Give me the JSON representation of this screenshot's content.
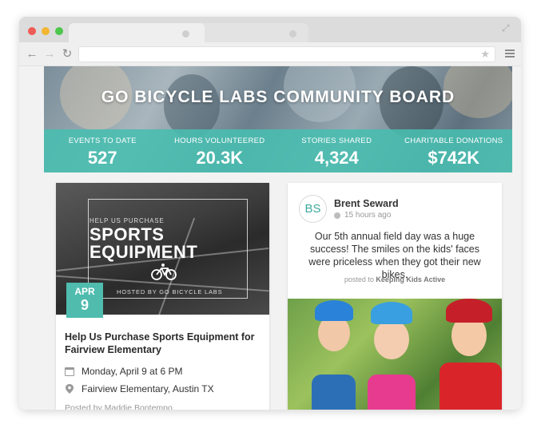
{
  "hero": {
    "title": "GO BICYCLE LABS COMMUNITY BOARD",
    "stats": [
      {
        "label": "EVENTS TO DATE",
        "value": "527"
      },
      {
        "label": "HOURS VOLUNTEERED",
        "value": "20.3K"
      },
      {
        "label": "STORIES SHARED",
        "value": "4,324"
      },
      {
        "label": "CHARITABLE DONATIONS",
        "value": "$742K"
      }
    ]
  },
  "event": {
    "graphic_line1": "HELP US PURCHASE",
    "graphic_line2": "SPORTS",
    "graphic_line3": "EQUIPMENT",
    "graphic_host": "HOSTED BY GO BICYCLE LABS",
    "date_month": "APR",
    "date_day": "9",
    "title": "Help Us Purchase Sports Equipment for Fairview Elementary",
    "when": "Monday, April 9 at 6 PM",
    "where": "Fairview Elementary, Austin TX",
    "poster": "Posted by Maddie Bontempo"
  },
  "story": {
    "initials": "BS",
    "author": "Brent Seward",
    "time": "15 hours ago",
    "text": "Our 5th annual field day was a huge success! The smiles on the kids' faces were priceless when they got their new bikes.",
    "posted_prefix": "posted to",
    "posted_group": "Keeping Kids Active"
  },
  "colors": {
    "accent": "#4fbcae",
    "window_red": "#ee5b55",
    "window_yellow": "#f2b632",
    "window_green": "#4cc64b"
  },
  "icons": [
    "back-arrow-icon",
    "forward-arrow-icon",
    "reload-icon",
    "star-icon",
    "menu-icon",
    "resize-icon",
    "bike-icon",
    "calendar-icon",
    "pin-icon",
    "clock-icon"
  ]
}
